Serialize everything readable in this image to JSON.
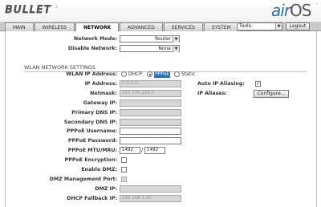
{
  "header": {
    "logo": "BULLET",
    "logo_mark": "2",
    "brand_air": "air",
    "brand_os": "OS",
    "brand_tm": "™"
  },
  "tabs": [
    {
      "label": "MAIN"
    },
    {
      "label": "WIRELESS"
    },
    {
      "label": "NETWORK",
      "active": true
    },
    {
      "label": "ADVANCED"
    },
    {
      "label": "SERVICES"
    },
    {
      "label": "SYSTEM"
    }
  ],
  "toolbar": {
    "tools_value": "Tools:",
    "logout_label": "Logout"
  },
  "network": {
    "mode_label": "Network Mode:",
    "mode_value": "Router",
    "disable_label": "Disable Network:",
    "disable_value": "None"
  },
  "wlan": {
    "section_title": "WLAN NETWORK SETTINGS",
    "ip_address_label": "WLAN IP Address:",
    "radio_options": [
      "DHCP",
      "PPPoE",
      "Static"
    ],
    "radio_selected": "PPPoE",
    "fields": {
      "ip_address": {
        "label": "IP Address:",
        "value": "0.0.0.0"
      },
      "netmask": {
        "label": "Netmask:",
        "value": "255.255.255.0"
      },
      "gateway": {
        "label": "Gateway IP:",
        "value": ""
      },
      "primary_dns": {
        "label": "Primary DNS IP:",
        "value": ""
      },
      "secondary_dns": {
        "label": "Secondary DNS IP:",
        "value": ""
      },
      "pppoe_username": {
        "label": "PPPoE Username:",
        "value": ""
      },
      "pppoe_password": {
        "label": "PPPoE Password:",
        "value": ""
      },
      "pppoe_mtu_mru": {
        "label": "PPPoE MTU/MRU:",
        "mtu": "1492",
        "mru": "1492",
        "separator": "/"
      },
      "pppoe_encryption": {
        "label": "PPPoE Encryption:",
        "checked": false
      },
      "enable_dmz": {
        "label": "Enable DMZ:",
        "checked": false
      },
      "dmz_mgmt_port": {
        "label": "DMZ Management Port:",
        "checked": true
      },
      "dmz_ip": {
        "label": "DMZ IP:",
        "value": ""
      },
      "dhcp_fallback_ip": {
        "label": "DHCP Fallback IP:",
        "value": "192.168.1.20"
      }
    },
    "auto_ip_aliasing": {
      "label": "Auto IP Aliasing:",
      "checked": true
    },
    "ip_aliases": {
      "label": "IP Aliases:",
      "button_label": "Configure..."
    }
  },
  "colors": {
    "accent": "#2f6cb0",
    "tab_bar": "#c9c9c9",
    "disabled_field": "#d6d6d6"
  }
}
